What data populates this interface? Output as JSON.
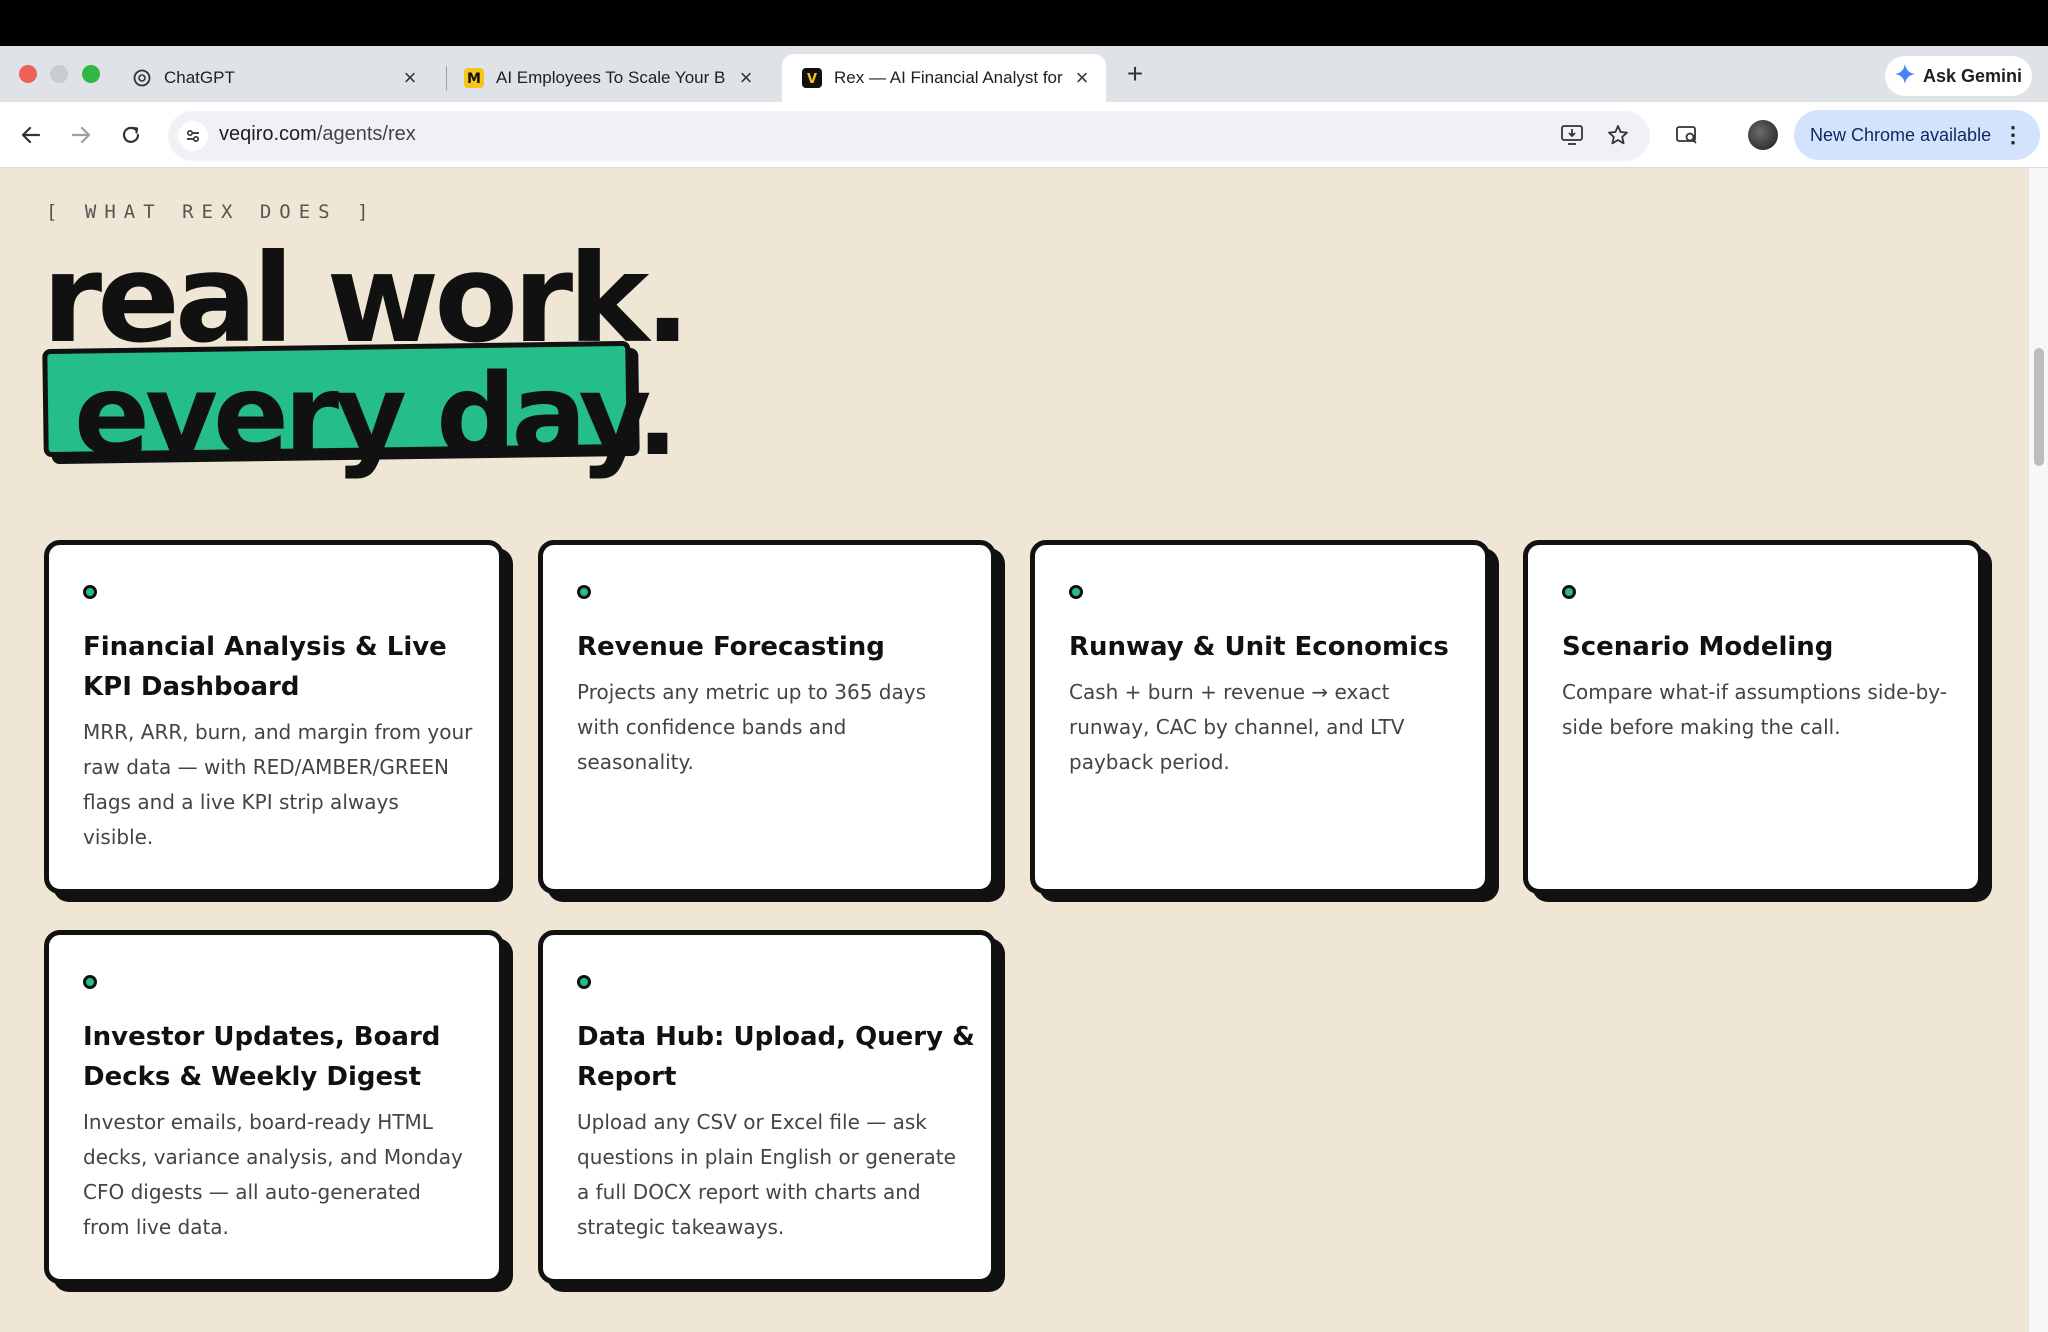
{
  "browser": {
    "tabs": [
      {
        "title": "ChatGPT",
        "icon": "chatgpt-icon"
      },
      {
        "title": "AI Employees To Scale Your B",
        "icon": "m-logo-icon"
      },
      {
        "title": "Rex — AI Financial Analyst for",
        "icon": "veqiro-icon",
        "active": true
      }
    ],
    "ask_gemini": "Ask Gemini",
    "url_host": "veqiro.com",
    "url_path": "/agents/rex",
    "chrome_update": "New Chrome available"
  },
  "page": {
    "eyebrow": "[ WHAT REX DOES ]",
    "headline_line1": "real work.",
    "headline_line2": "every day.",
    "accent_color": "#25bd88",
    "cards": [
      {
        "title": "Financial Analysis & Live KPI Dashboard",
        "desc": "MRR, ARR, burn, and margin from your raw data — with RED/AMBER/GREEN flags and a live KPI strip always visible."
      },
      {
        "title": "Revenue Forecasting",
        "desc": "Projects any metric up to 365 days with confidence bands and seasonality."
      },
      {
        "title": "Runway & Unit Economics",
        "desc": "Cash + burn + revenue → exact runway, CAC by channel, and LTV payback period."
      },
      {
        "title": "Scenario Modeling",
        "desc": "Compare what-if assumptions side-by-side before making the call."
      },
      {
        "title": "Investor Updates, Board Decks & Weekly Digest",
        "desc": "Investor emails, board-ready HTML decks, variance analysis, and Monday CFO digests — all auto-generated from live data."
      },
      {
        "title": "Data Hub: Upload, Query & Report",
        "desc": "Upload any CSV or Excel file — ask questions in plain English or generate a full DOCX report with charts and strategic takeaways."
      }
    ]
  }
}
